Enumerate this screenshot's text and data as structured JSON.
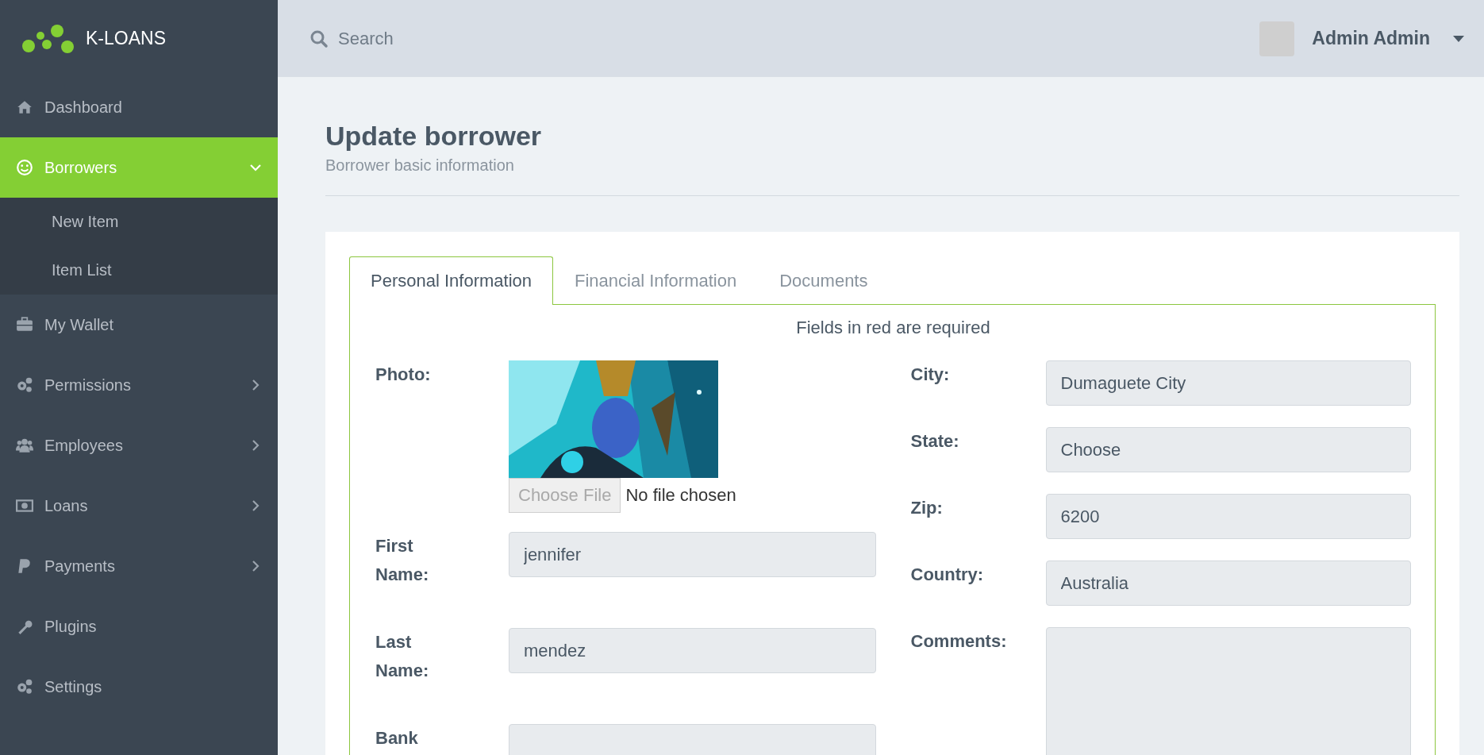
{
  "brand": {
    "name": "K-LOANS"
  },
  "sidebar": {
    "items": [
      {
        "label": "Dashboard",
        "selected": false,
        "expandable": false,
        "expanded": false
      },
      {
        "label": "Borrowers",
        "selected": true,
        "expandable": true,
        "expanded": true,
        "children": [
          {
            "label": "New Item"
          },
          {
            "label": "Item List"
          }
        ]
      },
      {
        "label": "My Wallet",
        "selected": false,
        "expandable": false,
        "expanded": false
      },
      {
        "label": "Permissions",
        "selected": false,
        "expandable": true,
        "expanded": false
      },
      {
        "label": "Employees",
        "selected": false,
        "expandable": true,
        "expanded": false
      },
      {
        "label": "Loans",
        "selected": false,
        "expandable": true,
        "expanded": false
      },
      {
        "label": "Payments",
        "selected": false,
        "expandable": true,
        "expanded": false
      },
      {
        "label": "Plugins",
        "selected": false,
        "expandable": false,
        "expanded": false
      },
      {
        "label": "Settings",
        "selected": false,
        "expandable": false,
        "expanded": false
      }
    ]
  },
  "topbar": {
    "search": {
      "placeholder": "Search"
    },
    "user": {
      "name": "Admin Admin"
    }
  },
  "page": {
    "title": "Update borrower",
    "subtitle": "Borrower basic information"
  },
  "tabs": [
    {
      "label": "Personal Information",
      "selected": true
    },
    {
      "label": "Financial Information",
      "selected": false
    },
    {
      "label": "Documents",
      "selected": false
    }
  ],
  "form": {
    "note": "Fields in red are required",
    "photo": {
      "label": "Photo:",
      "button": "Choose File",
      "status": "No file chosen"
    },
    "left_fields": [
      {
        "label": "First Name:",
        "value": "jennifer"
      },
      {
        "label": "Last Name:",
        "value": "mendez"
      },
      {
        "label": "Bank"
      }
    ],
    "right_fields": [
      {
        "label": "City:",
        "value": "Dumaguete City",
        "kind": "input"
      },
      {
        "label": "State:",
        "value": "Choose",
        "kind": "input"
      },
      {
        "label": "Zip:",
        "value": "6200",
        "kind": "input"
      },
      {
        "label": "Country:",
        "value": "Australia",
        "kind": "input"
      },
      {
        "label": "Comments:",
        "kind": "textarea"
      }
    ]
  }
}
